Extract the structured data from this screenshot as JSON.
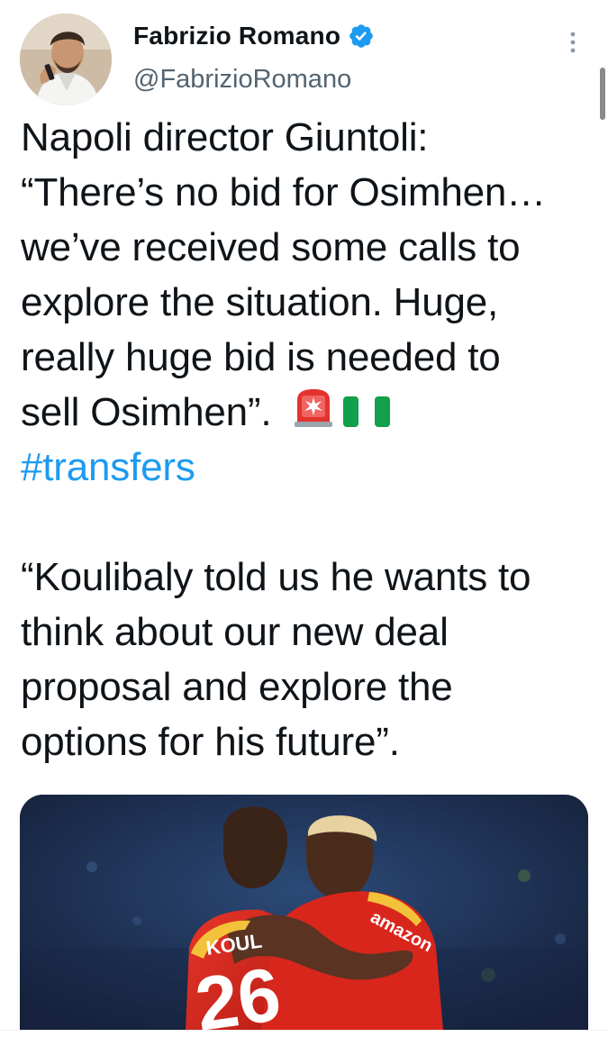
{
  "tweet": {
    "author": {
      "display_name": "Fabrizio Romano",
      "handle": "@FabrizioRomano",
      "verified": true,
      "avatar_icon": "author-avatar"
    },
    "more_icon": "more-vertical-icon",
    "text_lines": [
      "Napoli director Giuntoli:",
      "“There’s no bid for Osimhen…",
      "we’ve received some calls to",
      "explore the situation. Huge,",
      "really huge bid is needed to",
      "sell Osimhen”."
    ],
    "emojis": [
      "police-car-light-emoji",
      "nigeria-flag-emoji"
    ],
    "hashtag": "#transfers",
    "text_lines_2": [
      "“Koulibaly told us he wants to",
      "think about our new deal",
      "proposal and explore the",
      "options for his future”."
    ],
    "media": {
      "type": "photo",
      "jersey_text": "KOUL",
      "jersey_number": "26",
      "sponsor": "amazon"
    }
  },
  "colors": {
    "text": "#0f1419",
    "secondary_text": "#536471",
    "link": "#1d9bf0",
    "verified_badge": "#1d9bf0",
    "jersey_red": "#d9261c"
  }
}
